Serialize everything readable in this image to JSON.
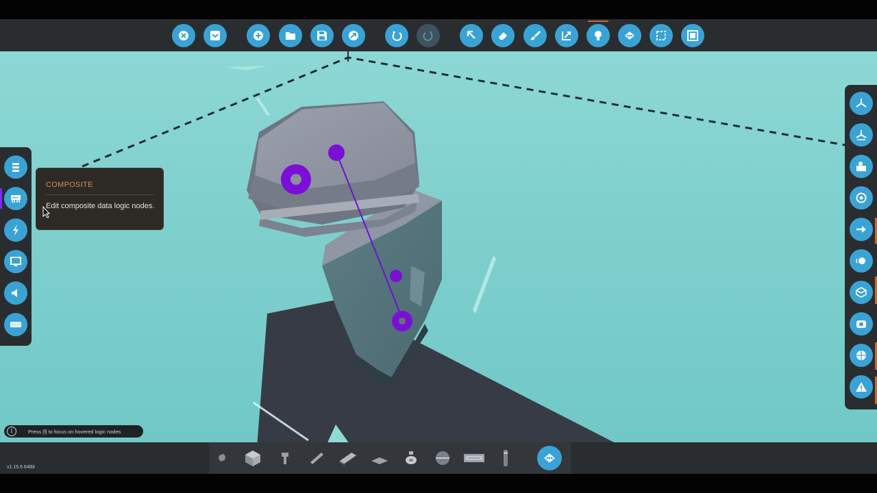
{
  "app": {
    "version": "v1.15.6 64Bit"
  },
  "top_toolbar": {
    "buttons": [
      {
        "name": "close-button",
        "icon": "close-icon"
      },
      {
        "name": "dropdown-menu-button",
        "icon": "chevron-down-icon"
      },
      {
        "name": "add-button",
        "icon": "plus-icon"
      },
      {
        "name": "open-folder-button",
        "icon": "folder-icon"
      },
      {
        "name": "save-button",
        "icon": "save-icon"
      },
      {
        "name": "upload-button",
        "icon": "upload-icon"
      },
      {
        "name": "undo-button",
        "icon": "undo-icon"
      },
      {
        "name": "redo-button",
        "icon": "redo-icon",
        "disabled": true
      },
      {
        "name": "select-tool-button",
        "icon": "cursor-arrow-icon"
      },
      {
        "name": "eraser-tool-button",
        "icon": "eraser-icon"
      },
      {
        "name": "paint-tool-button",
        "icon": "paint-brush-icon"
      },
      {
        "name": "resize-tool-button",
        "icon": "scale-arrow-icon"
      },
      {
        "name": "logic-tool-button",
        "icon": "light-bulb-icon",
        "active": true
      },
      {
        "name": "composite-view-button",
        "icon": "composite-node-icon"
      },
      {
        "name": "selection-box-button",
        "icon": "dashed-square-icon"
      },
      {
        "name": "frame-button",
        "icon": "frame-icon"
      }
    ]
  },
  "left_sidebar": {
    "items": [
      {
        "name": "list-panel-button",
        "icon": "stack-icon"
      },
      {
        "name": "composite-panel-button",
        "icon": "composite-icon",
        "selected": true
      },
      {
        "name": "electric-panel-button",
        "icon": "lightning-icon"
      },
      {
        "name": "video-panel-button",
        "icon": "monitor-icon"
      },
      {
        "name": "audio-panel-button",
        "icon": "speaker-icon"
      },
      {
        "name": "keypad-panel-button",
        "icon": "keyboard-icon"
      }
    ]
  },
  "right_sidebar": {
    "items": [
      {
        "name": "view-axes-button",
        "icon": "axes-icon"
      },
      {
        "name": "view-axes-alt-button",
        "icon": "axes-alt-icon"
      },
      {
        "name": "camera-button",
        "icon": "camera-icon"
      },
      {
        "name": "target-button",
        "icon": "target-icon"
      },
      {
        "name": "flow-button",
        "icon": "arrow-flow-icon"
      },
      {
        "name": "toggle-button",
        "icon": "toggle-icon"
      },
      {
        "name": "cube-button",
        "icon": "cube-icon"
      },
      {
        "name": "snapshot-button",
        "icon": "snapshot-icon"
      },
      {
        "name": "physics-button",
        "icon": "globe-icon"
      },
      {
        "name": "warning-button",
        "icon": "warning-icon"
      }
    ]
  },
  "tooltip": {
    "title": "COMPOSITE",
    "description": "Edit composite data logic nodes."
  },
  "hint": {
    "text": "Press [f] to focus on hovered logic nodes"
  },
  "bottom_toolbar": {
    "parts": [
      {
        "name": "part-small-block",
        "icon": "small-block-icon"
      },
      {
        "name": "part-cube",
        "icon": "cube-block-icon"
      },
      {
        "name": "part-pipe",
        "icon": "pipe-icon"
      },
      {
        "name": "part-wedge",
        "icon": "wedge-icon"
      },
      {
        "name": "part-plate",
        "icon": "plate-icon"
      },
      {
        "name": "part-flat-wedge",
        "icon": "flat-wedge-icon"
      },
      {
        "name": "part-weight",
        "icon": "weight-icon"
      },
      {
        "name": "part-sphere",
        "icon": "sphere-icon"
      },
      {
        "name": "part-panel",
        "icon": "panel-icon"
      },
      {
        "name": "part-rod",
        "icon": "rod-icon"
      }
    ],
    "composite_button": {
      "name": "composite-mode-button",
      "icon": "composite-node-icon"
    }
  },
  "colors": {
    "accent": "#3aa3d6",
    "toolbar_bg": "#2a2d30",
    "sky": "#7fd0cc",
    "logic_node": "#7a0fd8",
    "tooltip_title": "#d38b56"
  }
}
